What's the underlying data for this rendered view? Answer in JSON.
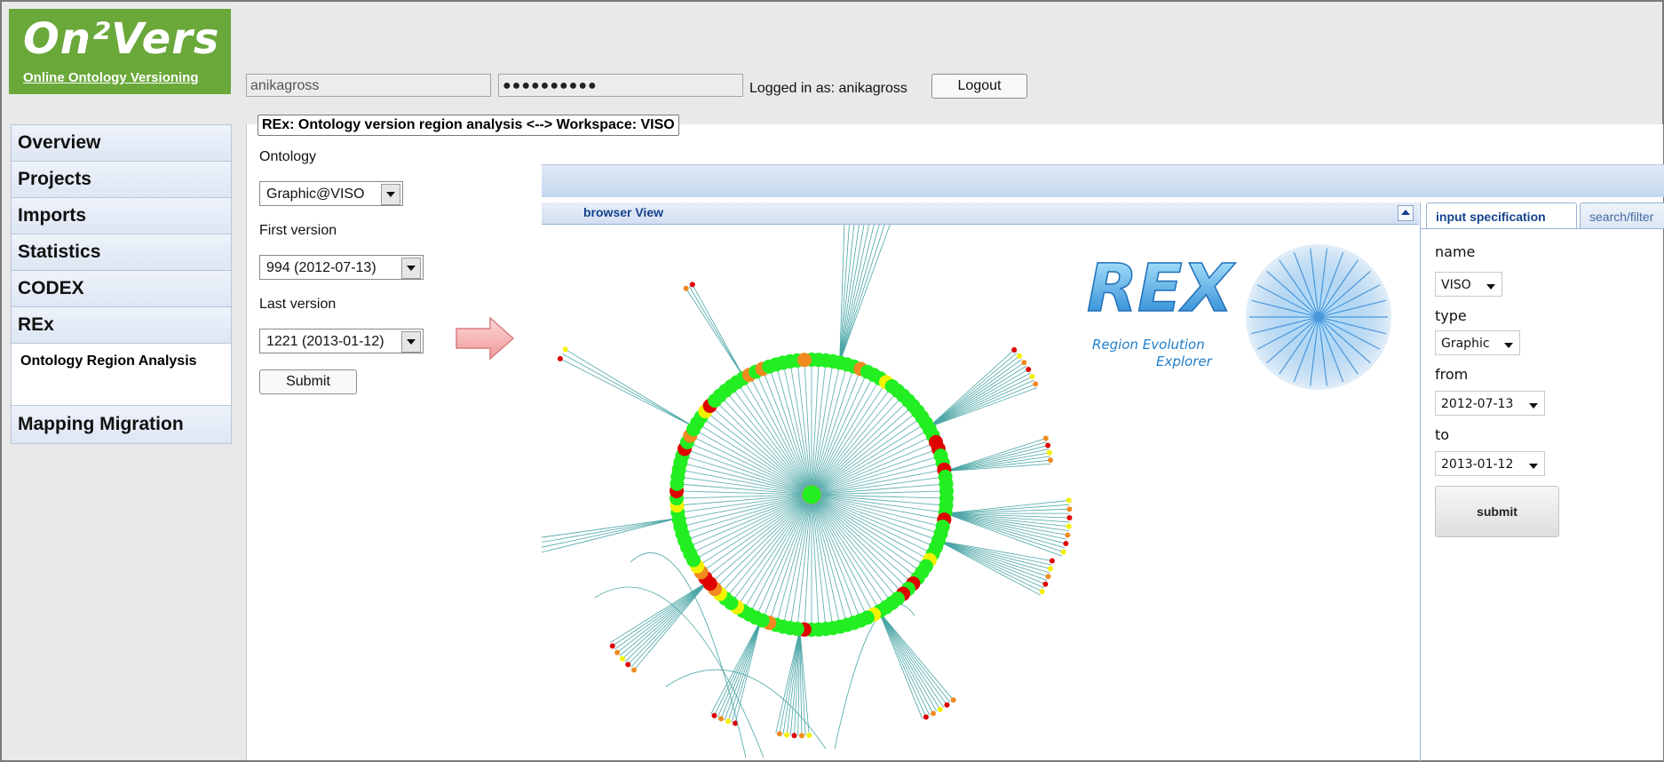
{
  "logo": {
    "title": "On²Vers",
    "subtitle": "Online Ontology Versioning"
  },
  "login": {
    "username": "anikagross",
    "password": "●●●●●●●●●●",
    "status": "Logged in as: anikagross",
    "logout_label": "Logout"
  },
  "nav": {
    "items": [
      "Overview",
      "Projects",
      "Imports",
      "Statistics",
      "CODEX",
      "REx"
    ],
    "sub_item": "Ontology Region Analysis",
    "last_item": "Mapping Migration"
  },
  "panel": {
    "legend": "REx: Ontology version region analysis <--> Workspace: VISO",
    "ontology_label": "Ontology",
    "ontology_value": "Graphic@VISO",
    "first_label": "First version",
    "first_value": "994 (2012-07-13)",
    "last_label": "Last version",
    "last_value": "1221 (2013-01-12)",
    "submit_label": "Submit"
  },
  "browser": {
    "title": "browser View",
    "rex_logo_text": "REX",
    "rex_logo_line1": "Region Evolution",
    "rex_logo_line2": "Explorer"
  },
  "right_panel": {
    "tabs": [
      "input specification",
      "search/filter"
    ],
    "name_label": "name",
    "name_value": "VISO",
    "type_label": "type",
    "type_value": "Graphic",
    "from_label": "from",
    "from_value": "2012-07-13",
    "to_label": "to",
    "to_value": "2013-01-12",
    "submit_label": "submit"
  },
  "colors": {
    "logo_green": "#6aa83a",
    "node_green": "#22ee22",
    "node_red": "#e00000",
    "node_yellow": "#f2f200",
    "node_orange": "#f08a20",
    "edge_teal": "#4aa5a5",
    "header_blue": "#15428b"
  }
}
